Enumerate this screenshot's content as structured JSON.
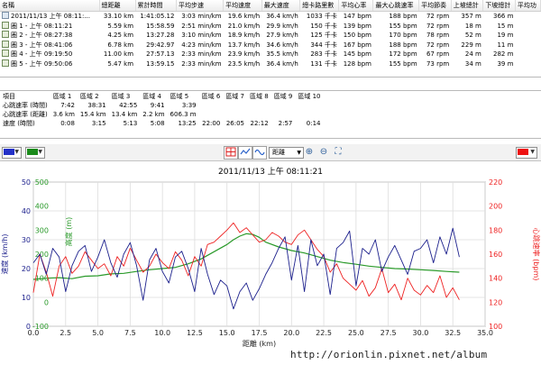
{
  "laps": {
    "headers": [
      "名稱",
      "總距離",
      "累計時間",
      "平均步速",
      "平均速度",
      "最大速度",
      "總卡路里數",
      "平均心率",
      "最大心跳速率",
      "平均節奏",
      "上坡總計",
      "下坡總計",
      "平均功"
    ],
    "rows": [
      {
        "icon": "activity",
        "cells": [
          "2011/11/13 上午 08:11:...",
          "33.10 km",
          "1:41:05.12",
          "3:03 min/km",
          "19.6 km/h",
          "36.4 km/h",
          "1033 千卡",
          "147 bpm",
          "188 bpm",
          "72 rpm",
          "357 m",
          "366 m",
          ""
        ]
      },
      {
        "icon": "lap",
        "cells": [
          "圈 1 - 上午 08:11:21",
          "5.59 km",
          "15:58.59",
          "2:51 min/km",
          "21.0 km/h",
          "29.9 km/h",
          "150 千卡",
          "139 bpm",
          "155 bpm",
          "72 rpm",
          "18 m",
          "15 m",
          ""
        ]
      },
      {
        "icon": "lap",
        "cells": [
          "圈 2 - 上午 08:27:38",
          "4.25 km",
          "13:27.28",
          "3:10 min/km",
          "18.9 km/h",
          "27.9 km/h",
          "125 千卡",
          "150 bpm",
          "170 bpm",
          "78 rpm",
          "52 m",
          "19 m",
          ""
        ]
      },
      {
        "icon": "lap",
        "cells": [
          "圈 3 - 上午 08:41:06",
          "6.78 km",
          "29:42.97",
          "4:23 min/km",
          "13.7 km/h",
          "34.6 km/h",
          "344 千卡",
          "167 bpm",
          "188 bpm",
          "72 rpm",
          "229 m",
          "11 m",
          ""
        ]
      },
      {
        "icon": "lap",
        "cells": [
          "圈 4 - 上午 09:19:50",
          "11.00 km",
          "27:57.13",
          "2:33 min/km",
          "23.9 km/h",
          "35.5 km/h",
          "283 千卡",
          "145 bpm",
          "172 bpm",
          "67 rpm",
          "24 m",
          "282 m",
          ""
        ]
      },
      {
        "icon": "lap",
        "cells": [
          "圈 5 - 上午 09:50:06",
          "5.47 km",
          "13:59.15",
          "2:33 min/km",
          "23.5 km/h",
          "36.4 km/h",
          "131 千卡",
          "128 bpm",
          "155 bpm",
          "73 rpm",
          "34 m",
          "39 m",
          ""
        ]
      }
    ]
  },
  "zones": {
    "headers": [
      "項目",
      "區域 1",
      "區域 2",
      "區域 3",
      "區域 4",
      "區域 5",
      "區域 6",
      "區域 7",
      "區域 8",
      "區域 9",
      "區域 10"
    ],
    "rows": [
      [
        "心跳速率 (時間)",
        "7:42",
        "38:31",
        "42:55",
        "9:41",
        "3:39",
        "",
        "",
        "",
        "",
        ""
      ],
      [
        "心跳速率 (距離)",
        "3.6 km",
        "15.4 km",
        "13.4 km",
        "2.2 km",
        "606.3 m",
        "",
        "",
        "",
        "",
        ""
      ],
      [
        "速度 (時間)",
        "0:08",
        "3:15",
        "5:13",
        "5:08",
        "13:25",
        "22:00",
        "26:05",
        "22:12",
        "2:57",
        "0:14"
      ]
    ]
  },
  "toolbar": {
    "left_color_1": "#2431c8",
    "left_color_2": "#1a8a1a",
    "right_color": "#ee1111",
    "axis_mode": "距離"
  },
  "colors": {
    "speed": "#1b1f8c",
    "altitude": "#2a9a2a",
    "heart_rate": "#ee2222"
  },
  "watermark": "http://orionlin.pixnet.net/album",
  "chart_data": {
    "type": "line",
    "title": "2011/11/13 上午 08:11:21",
    "xlabel": "距離 (km)",
    "xlim": [
      0,
      35
    ],
    "x_ticks": [
      "0.0",
      "2.5",
      "5.0",
      "7.5",
      "10.0",
      "12.5",
      "15.0",
      "17.5",
      "20.0",
      "22.5",
      "25.0",
      "27.5",
      "30.0",
      "32.5",
      "35.0"
    ],
    "axes": [
      {
        "side": "left",
        "label": "速度 (km/h)",
        "color": "#1b1f8c",
        "ticks": [
          "0",
          "10",
          "20",
          "30",
          "40",
          "50"
        ],
        "ylim": [
          0,
          50
        ]
      },
      {
        "side": "left-inner",
        "label": "高度 (m)",
        "color": "#2a9a2a",
        "ticks": [
          "-100",
          "0",
          "100",
          "200",
          "300",
          "400",
          "500"
        ],
        "ylim": [
          -100,
          500
        ]
      },
      {
        "side": "right",
        "label": "心跳速率 (bpm)",
        "color": "#ee2222",
        "ticks": [
          "100",
          "120",
          "140",
          "160",
          "180",
          "200",
          "220"
        ],
        "ylim": [
          100,
          220
        ]
      }
    ],
    "series": [
      {
        "name": "速度",
        "axis": 0,
        "x": [
          0.0,
          0.5,
          1.0,
          1.5,
          2.0,
          2.5,
          3.0,
          3.5,
          4.0,
          4.5,
          5.0,
          5.5,
          6.0,
          6.5,
          7.0,
          7.5,
          8.0,
          8.5,
          9.0,
          9.5,
          10.0,
          10.5,
          11.0,
          11.5,
          12.0,
          12.5,
          13.0,
          13.5,
          14.0,
          14.5,
          15.0,
          15.5,
          16.0,
          16.5,
          17.0,
          17.5,
          18.0,
          18.5,
          19.0,
          19.5,
          20.0,
          20.5,
          21.0,
          21.5,
          22.0,
          22.5,
          23.0,
          23.5,
          24.0,
          24.5,
          25.0,
          25.5,
          26.0,
          26.5,
          27.0,
          27.5,
          28.0,
          28.5,
          29.0,
          29.5,
          30.0,
          30.5,
          31.0,
          31.5,
          32.0,
          32.5,
          33.0
        ],
        "y": [
          22,
          25,
          18,
          27,
          24,
          12,
          21,
          26,
          28,
          19,
          24,
          30,
          22,
          17,
          25,
          29,
          21,
          9,
          23,
          27,
          19,
          15,
          24,
          26,
          20,
          12,
          27,
          18,
          11,
          16,
          14,
          6,
          12,
          15,
          9,
          13,
          18,
          22,
          27,
          31,
          16,
          28,
          12,
          30,
          21,
          25,
          11,
          27,
          29,
          33,
          14,
          27,
          25,
          30,
          19,
          24,
          28,
          23,
          18,
          26,
          27,
          30,
          22,
          31,
          25,
          34,
          24
        ]
      },
      {
        "name": "高度",
        "axis": 1,
        "x": [
          0.0,
          1.0,
          2.0,
          3.0,
          4.0,
          5.0,
          6.0,
          7.0,
          8.0,
          9.0,
          10.0,
          11.0,
          12.0,
          13.0,
          14.0,
          15.0,
          15.5,
          16.0,
          16.5,
          17.0,
          17.5,
          18.0,
          19.0,
          20.0,
          21.0,
          22.0,
          23.0,
          24.0,
          25.0,
          26.0,
          27.0,
          28.0,
          29.0,
          30.0,
          31.0,
          32.0,
          33.0
        ],
        "y": [
          95,
          100,
          102,
          98,
          108,
          110,
          118,
          120,
          128,
          135,
          140,
          145,
          160,
          180,
          210,
          240,
          260,
          275,
          285,
          282,
          270,
          250,
          230,
          215,
          205,
          190,
          175,
          165,
          158,
          150,
          145,
          140,
          138,
          135,
          132,
          128,
          125
        ]
      },
      {
        "name": "心跳速率",
        "axis": 2,
        "x": [
          0.0,
          0.5,
          1.0,
          1.5,
          2.0,
          2.5,
          3.0,
          3.5,
          4.0,
          4.5,
          5.0,
          5.5,
          6.0,
          6.5,
          7.0,
          7.5,
          8.0,
          8.5,
          9.0,
          9.5,
          10.0,
          10.5,
          11.0,
          11.5,
          12.0,
          12.5,
          13.0,
          13.5,
          14.0,
          14.5,
          15.0,
          15.5,
          16.0,
          16.5,
          17.0,
          17.5,
          18.0,
          18.5,
          19.0,
          19.5,
          20.0,
          20.5,
          21.0,
          21.5,
          22.0,
          22.5,
          23.0,
          23.5,
          24.0,
          24.5,
          25.0,
          25.5,
          26.0,
          26.5,
          27.0,
          27.5,
          28.0,
          28.5,
          29.0,
          29.5,
          30.0,
          30.5,
          31.0,
          31.5,
          32.0,
          32.5,
          33.0
        ],
        "y": [
          128,
          160,
          145,
          125,
          150,
          158,
          144,
          150,
          162,
          155,
          148,
          152,
          142,
          158,
          150,
          165,
          155,
          145,
          150,
          160,
          153,
          148,
          162,
          155,
          142,
          158,
          150,
          168,
          170,
          175,
          180,
          186,
          178,
          182,
          176,
          170,
          172,
          178,
          175,
          170,
          168,
          176,
          180,
          172,
          164,
          158,
          145,
          152,
          140,
          135,
          130,
          138,
          125,
          132,
          148,
          128,
          135,
          122,
          140,
          130,
          126,
          134,
          128,
          142,
          124,
          132,
          122
        ]
      }
    ]
  }
}
